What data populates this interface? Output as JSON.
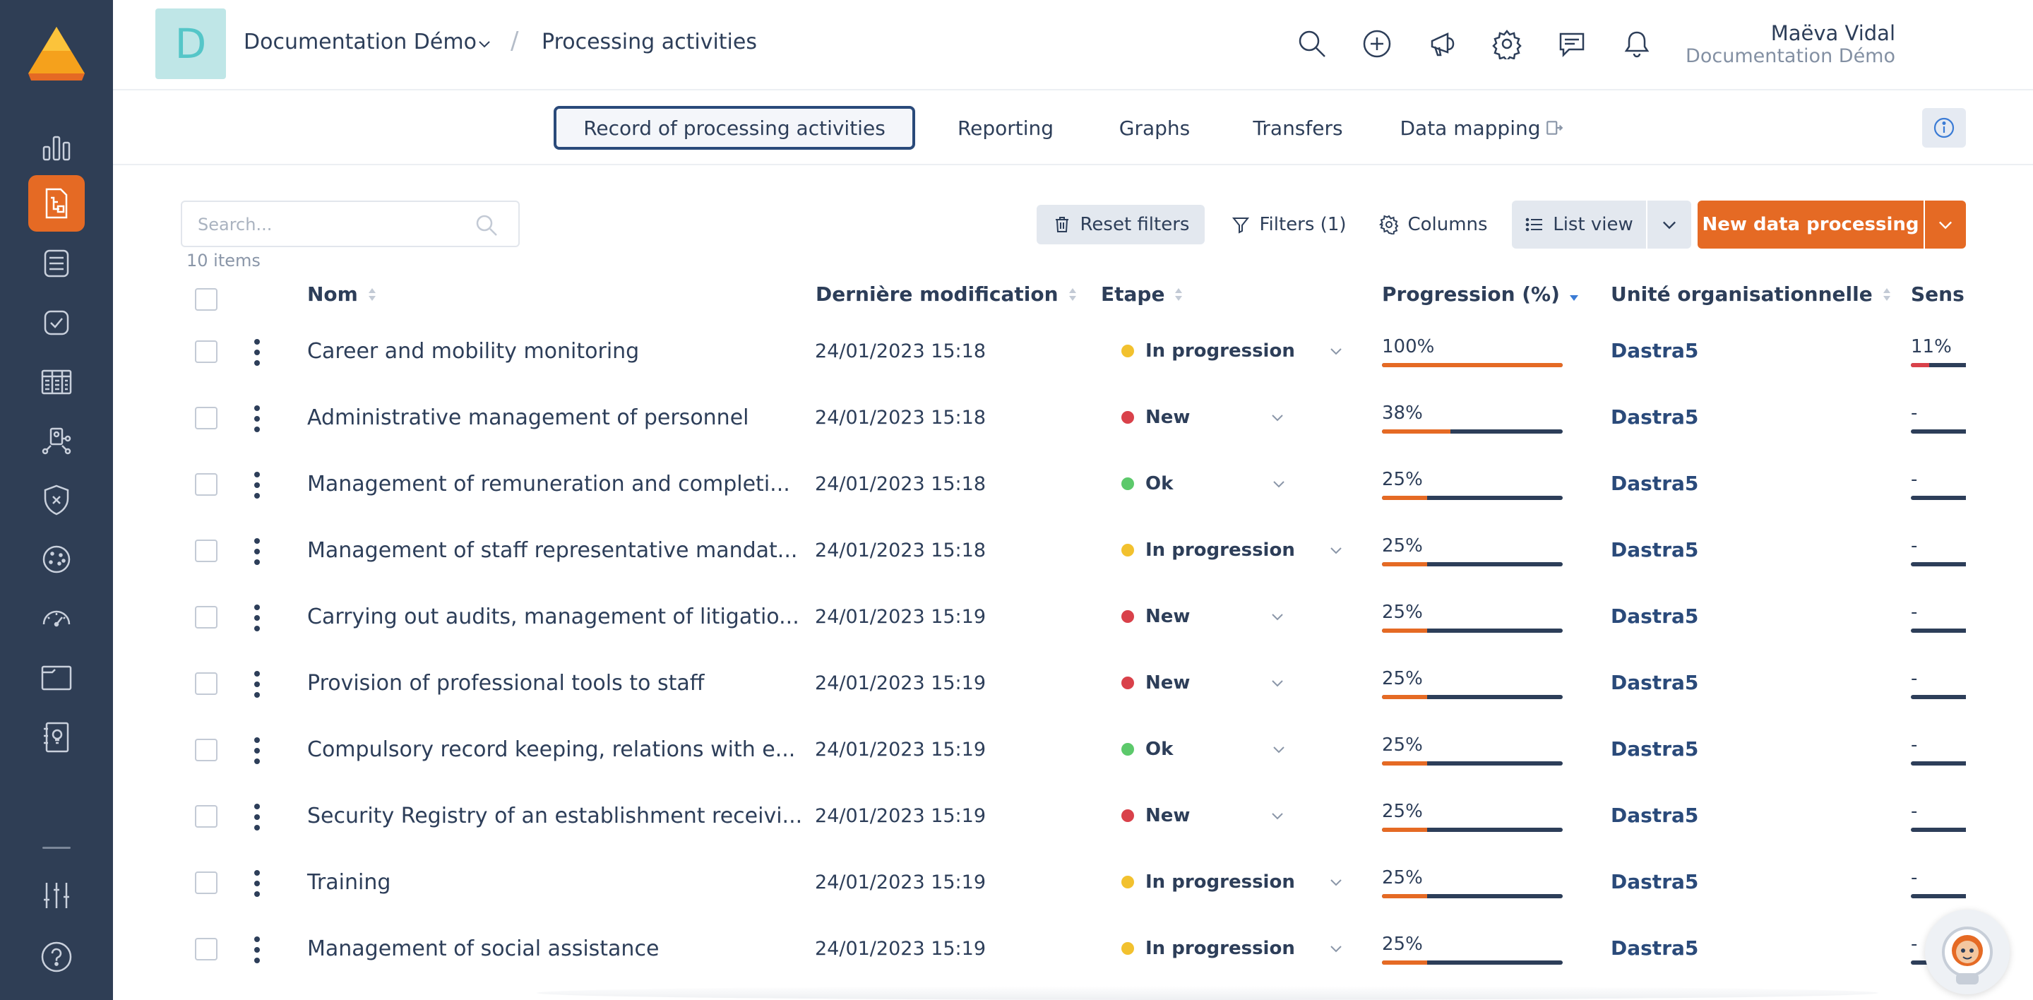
{
  "workspace": {
    "initial": "D",
    "name": "Documentation Démo"
  },
  "breadcrumb": {
    "separator": "/",
    "title": "Processing activities"
  },
  "user": {
    "name": "Maëva Vidal",
    "org": "Documentation Démo"
  },
  "tabs": [
    {
      "label": "Record of processing activities",
      "active": true
    },
    {
      "label": "Reporting",
      "active": false
    },
    {
      "label": "Graphs",
      "active": false
    },
    {
      "label": "Transfers",
      "active": false
    },
    {
      "label": "Data mapping",
      "active": false
    }
  ],
  "toolbar": {
    "search_placeholder": "Search...",
    "items_count": "10 items",
    "reset_filters": "Reset filters",
    "filters": "Filters (1)",
    "columns": "Columns",
    "list_view": "List view",
    "new_processing": "New data processing"
  },
  "columns": {
    "name": "Nom",
    "modified": "Dernière modification",
    "step": "Etape",
    "progress": "Progression (%)",
    "unit": "Unité organisationnelle",
    "sensitivity": "Sensil"
  },
  "rows": [
    {
      "name": "Career and mobility monitoring",
      "modified": "24/01/2023 15:18",
      "step": "In progression",
      "step_color": "#f2c12e",
      "progress_label": "100%",
      "progress": 1.0,
      "unit": "Dastra5",
      "sensitivity": "11%",
      "sensitivity_value": 0.33
    },
    {
      "name": "Administrative management of personnel",
      "modified": "24/01/2023 15:18",
      "step": "New",
      "step_color": "#d9414a",
      "progress_label": "38%",
      "progress": 0.38,
      "unit": "Dastra5",
      "sensitivity": "-",
      "sensitivity_value": 0
    },
    {
      "name": "Management of remuneration and completi...",
      "modified": "24/01/2023 15:18",
      "step": "Ok",
      "step_color": "#5cc96b",
      "progress_label": "25%",
      "progress": 0.25,
      "unit": "Dastra5",
      "sensitivity": "-",
      "sensitivity_value": 0
    },
    {
      "name": "Management of staff representative mandat...",
      "modified": "24/01/2023 15:18",
      "step": "In progression",
      "step_color": "#f2c12e",
      "progress_label": "25%",
      "progress": 0.25,
      "unit": "Dastra5",
      "sensitivity": "-",
      "sensitivity_value": 0
    },
    {
      "name": "Carrying out audits, management of litigatio...",
      "modified": "24/01/2023 15:19",
      "step": "New",
      "step_color": "#d9414a",
      "progress_label": "25%",
      "progress": 0.25,
      "unit": "Dastra5",
      "sensitivity": "-",
      "sensitivity_value": 0
    },
    {
      "name": "Provision of professional tools to staff",
      "modified": "24/01/2023 15:19",
      "step": "New",
      "step_color": "#d9414a",
      "progress_label": "25%",
      "progress": 0.25,
      "unit": "Dastra5",
      "sensitivity": "-",
      "sensitivity_value": 0
    },
    {
      "name": "Compulsory record keeping, relations with e...",
      "modified": "24/01/2023 15:19",
      "step": "Ok",
      "step_color": "#5cc96b",
      "progress_label": "25%",
      "progress": 0.25,
      "unit": "Dastra5",
      "sensitivity": "-",
      "sensitivity_value": 0
    },
    {
      "name": "Security Registry of an establishment receivi...",
      "modified": "24/01/2023 15:19",
      "step": "New",
      "step_color": "#d9414a",
      "progress_label": "25%",
      "progress": 0.25,
      "unit": "Dastra5",
      "sensitivity": "-",
      "sensitivity_value": 0
    },
    {
      "name": "Training",
      "modified": "24/01/2023 15:19",
      "step": "In progression",
      "step_color": "#f2c12e",
      "progress_label": "25%",
      "progress": 0.25,
      "unit": "Dastra5",
      "sensitivity": "-",
      "sensitivity_value": 0
    },
    {
      "name": "Management of social assistance",
      "modified": "24/01/2023 15:19",
      "step": "In progression",
      "step_color": "#f2c12e",
      "progress_label": "25%",
      "progress": 0.25,
      "unit": "Dastra5",
      "sensitivity": "-",
      "sensitivity_value": 0
    }
  ],
  "colors": {
    "sidebar": "#2f3e55",
    "accent": "#e56a24",
    "text": "#2d3e59",
    "link": "#2a4a7a"
  },
  "icons": {
    "sidebar": [
      "bar-chart-icon",
      "processing-icon",
      "database-icon",
      "checklist-icon",
      "table-icon",
      "org-chart-icon",
      "shield-icon",
      "cookie-icon",
      "gauge-icon",
      "folder-icon",
      "ideas-icon",
      "settings-sliders-icon",
      "help-icon"
    ],
    "header": [
      "search-icon",
      "add-icon",
      "megaphone-icon",
      "gear-icon",
      "chat-icon",
      "bell-icon"
    ]
  }
}
